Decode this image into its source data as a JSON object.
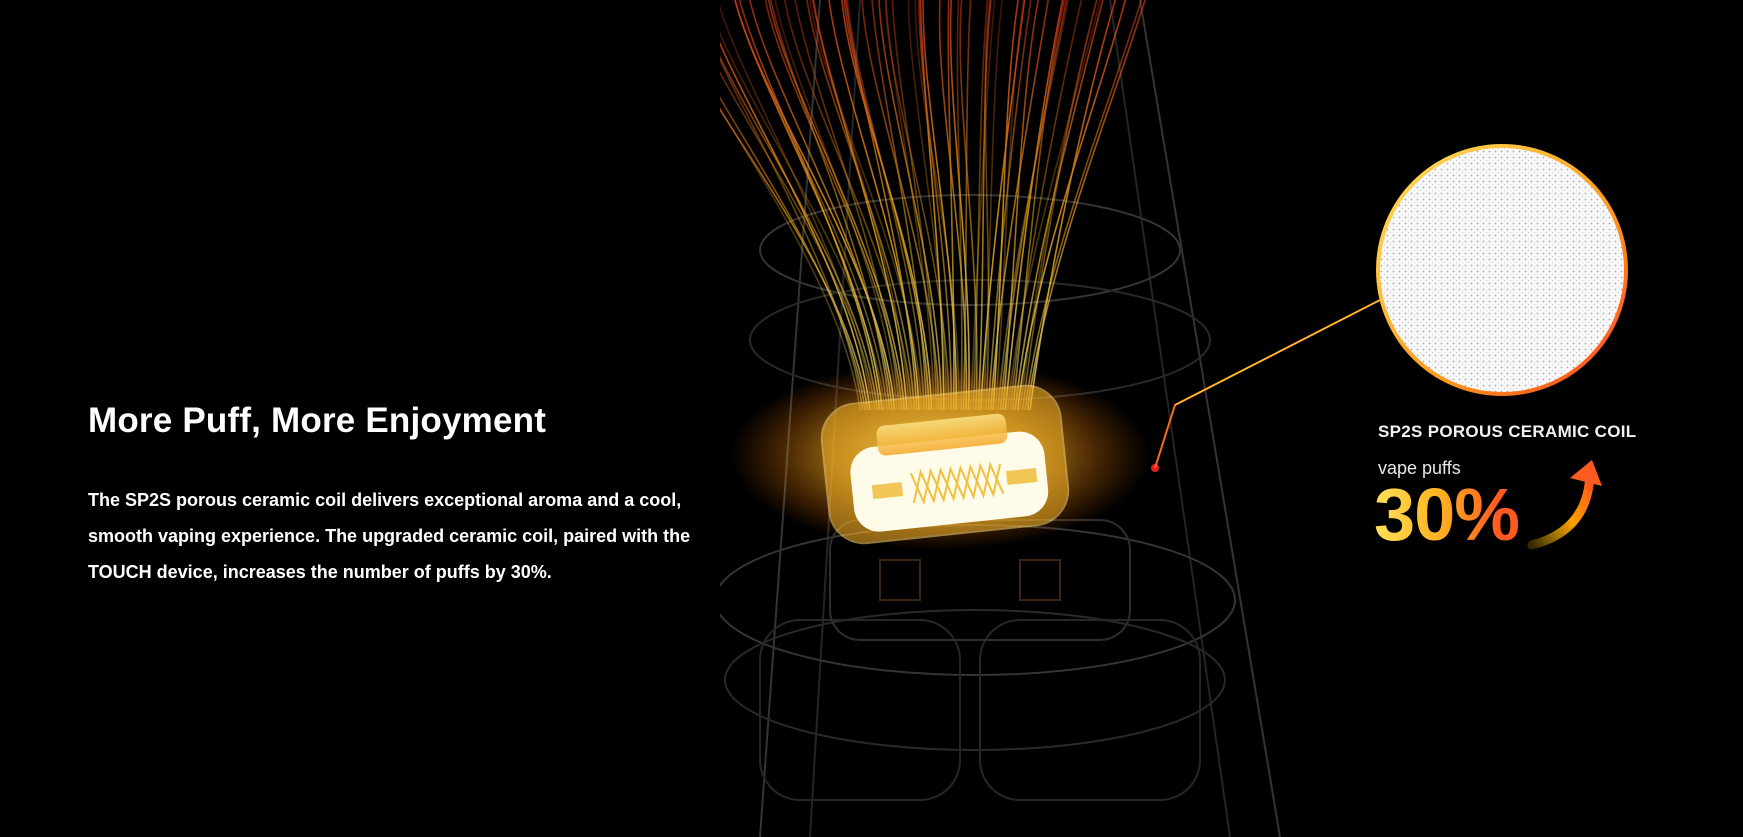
{
  "headline": "More Puff, More Enjoyment",
  "body": "The SP2S porous ceramic coil delivers exceptional aroma and a cool, smooth vaping experience. The upgraded ceramic coil, paired with the TOUCH device, increases the number of puffs by 30%.",
  "callout": {
    "title": "SP2S POROUS CERAMIC COIL",
    "label": "vape puffs",
    "value": "30%",
    "trend_icon": "arrow-up-icon"
  },
  "colors": {
    "background": "#000000",
    "text": "#ffffff",
    "accent_yellow": "#ffe15a",
    "accent_orange": "#ff9a1f",
    "accent_red": "#ff4a1f"
  }
}
